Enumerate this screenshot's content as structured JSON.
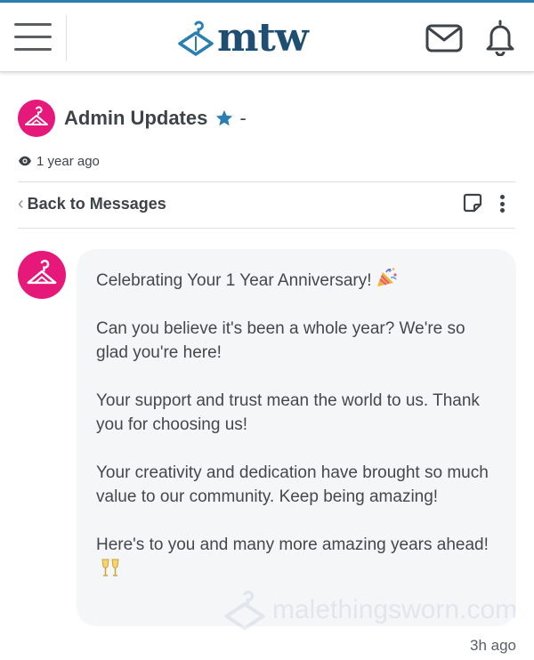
{
  "header": {
    "logo_text": "mtw",
    "icons": {
      "menu": "hamburger-menu-icon",
      "mail": "envelope-icon",
      "notifications": "bell-icon"
    },
    "accent": "#2a7fb0",
    "brand_color": "#1f4e73"
  },
  "thread": {
    "title": "Admin Updates",
    "title_suffix": "-",
    "star_color": "#2a7fb0",
    "views_text": "1 year ago",
    "back_label": "Back to Messages",
    "avatar_color": "#e6187a"
  },
  "message": {
    "paragraphs": [
      "Celebrating Your 1 Year Anniversary!",
      "Can you believe it's been a whole year? We're so glad you're here!",
      "Your support and trust mean the world to us. Thank you for choosing us!",
      "Your creativity and dedication have brought so much value to our community. Keep being amazing!",
      "Here's to you and many more amazing years ahead!"
    ],
    "emojis": [
      "party-popper-icon",
      "clinking-glasses-icon"
    ],
    "timestamp": "3h ago"
  },
  "watermark": {
    "text": "malethingsworn.com"
  }
}
